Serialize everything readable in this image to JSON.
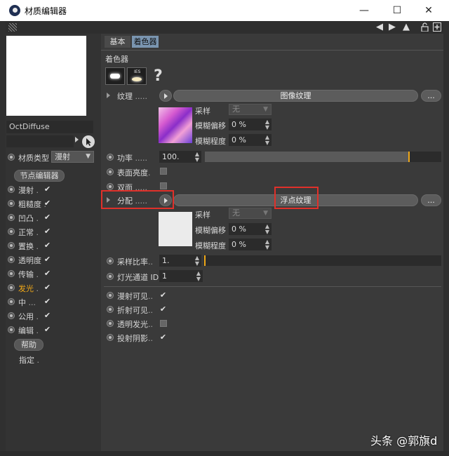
{
  "window": {
    "title": "材质编辑器",
    "minimize": "—",
    "maximize": "☐",
    "close": "✕"
  },
  "toolbar": {
    "lock_icon": "lock-icon",
    "new_icon": "new-window-icon"
  },
  "left": {
    "material_name": "OctDiffuse",
    "material_type_label": "材质类型",
    "material_type_value": "漫射",
    "node_editor": "节点编辑器",
    "channels": [
      {
        "label": "漫射",
        "dots": ".",
        "checked": true,
        "active": false
      },
      {
        "label": "粗糙度",
        "dots": ".",
        "checked": true,
        "active": false
      },
      {
        "label": "凹凸",
        "dots": ".",
        "checked": true,
        "active": false
      },
      {
        "label": "正常",
        "dots": ".",
        "checked": true,
        "active": false
      },
      {
        "label": "置换",
        "dots": ".",
        "checked": true,
        "active": false
      },
      {
        "label": "透明度",
        "dots": "",
        "checked": true,
        "active": false
      },
      {
        "label": "传输",
        "dots": ".",
        "checked": true,
        "active": false
      },
      {
        "label": "发光",
        "dots": ".",
        "checked": true,
        "active": true
      },
      {
        "label": "中",
        "dots": "...",
        "checked": true,
        "active": false
      },
      {
        "label": "公用",
        "dots": ".",
        "checked": true,
        "active": false
      },
      {
        "label": "编辑",
        "dots": ".",
        "checked": true,
        "active": false
      }
    ],
    "help": "帮助",
    "assign": "指定",
    "assign_dots": "."
  },
  "tabs": [
    {
      "label": "基本"
    },
    {
      "label": "着色器"
    }
  ],
  "section_title": "着色器",
  "texture": {
    "label": "纹理",
    "dots": ".....",
    "button": "图像纹理",
    "more": "...",
    "sample_label": "采样",
    "sample_value": "无",
    "blur_offset_label": "模糊偏移",
    "blur_offset_value": "0 %",
    "blur_scale_label": "模糊程度",
    "blur_scale_value": "0 %"
  },
  "power": {
    "label": "功率",
    "dots": ".....",
    "value": "100."
  },
  "surface_brightness": {
    "label": "表面亮度",
    "dots": "."
  },
  "double_sided": {
    "label": "双面",
    "dots": "....."
  },
  "distribution": {
    "label": "分配",
    "dots": ".....",
    "button": "浮点纹理",
    "more": "...",
    "sample_label": "采样",
    "sample_value": "无",
    "blur_offset_label": "模糊偏移",
    "blur_offset_value": "0 %",
    "blur_scale_label": "模糊程度",
    "blur_scale_value": "0 %"
  },
  "sample_rate": {
    "label": "采样比率",
    "dots": "..",
    "value": "1."
  },
  "light_pass": {
    "label": "灯光通道 ID",
    "value": "1"
  },
  "visibility": [
    {
      "label": "漫射可见",
      "dots": "..",
      "checked": true
    },
    {
      "label": "折射可见",
      "dots": "..",
      "checked": true
    },
    {
      "label": "透明发光",
      "dots": "..",
      "checked": false
    },
    {
      "label": "投射阴影",
      "dots": "..",
      "checked": true
    }
  ],
  "watermark": "头条 @郭旗d",
  "colors": {
    "accent": "#f0a818",
    "highlight_box": "#e0302a",
    "active_channel": "#f0a818"
  }
}
